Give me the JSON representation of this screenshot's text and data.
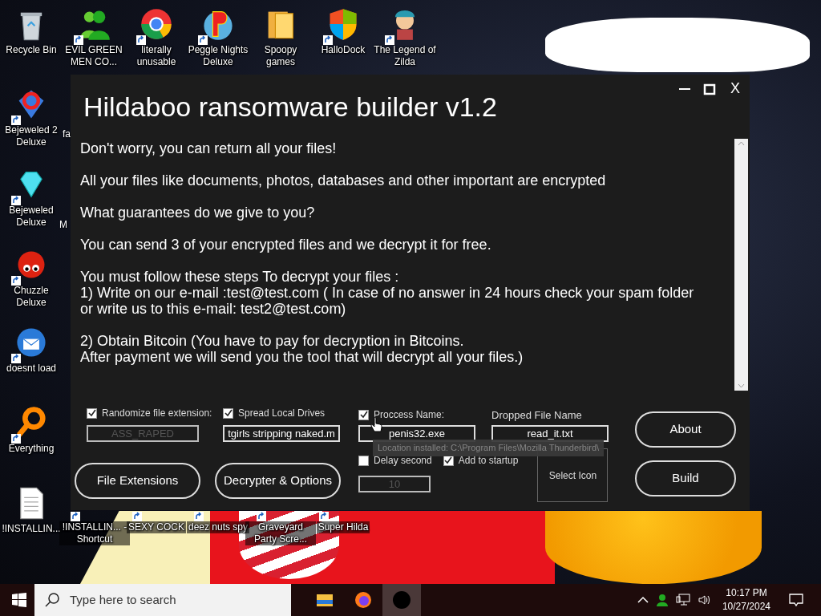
{
  "desktop": {
    "icons": [
      {
        "label": "Recycle Bin",
        "shortcut": false
      },
      {
        "label": "EVIL GREEN MEN CO...",
        "shortcut": true
      },
      {
        "label": "literally unusable",
        "shortcut": true
      },
      {
        "label": "Peggle Nights Deluxe",
        "shortcut": true
      },
      {
        "label": "Spoopy games",
        "shortcut": false
      },
      {
        "label": "HalloDock",
        "shortcut": true
      },
      {
        "label": "The Legend of Zilda",
        "shortcut": true
      },
      {
        "label": "Bejeweled 2 Deluxe",
        "shortcut": true
      },
      {
        "label": "Bejeweled Deluxe",
        "shortcut": true
      },
      {
        "label": "Chuzzle Deluxe",
        "shortcut": true
      },
      {
        "label": "doesnt load",
        "shortcut": true
      },
      {
        "label": "Everything",
        "shortcut": true
      },
      {
        "label": "!INSTALLIN...",
        "shortcut": false
      },
      {
        "label": "!INSTALLIN... - Shortcut",
        "shortcut": true
      },
      {
        "label": "SEXY COCK",
        "shortcut": true
      },
      {
        "label": "deez nuts spy",
        "shortcut": true
      },
      {
        "label": "Graveyard Party Scre...",
        "shortcut": true
      },
      {
        "label": "Super Hilda",
        "shortcut": true
      }
    ],
    "partial_labels": [
      "fa",
      "M"
    ]
  },
  "window": {
    "title": "Hildaboo ransomware builder v1.2",
    "close_label": "X",
    "message": [
      "Don't worry, you can return all your files!",
      "All your files like documents, photos, databases and other important are encrypted",
      "What guarantees do we give to you?",
      "You can send 3 of your encrypted files and we decrypt it for free.",
      "You must follow these steps To decrypt your files :\n1) Write on our e-mail :test@test.com ( In case of no answer in 24 hours check your spam folder\nor write us to this e-mail: test2@test.com)",
      "2) Obtain Bitcoin (You have to pay for decryption in Bitcoins.\nAfter payment we will send you the tool that will decrypt all your files.)"
    ],
    "checkboxes": [
      {
        "label": "Randomize file extension:",
        "checked": true
      },
      {
        "label": "Spread Local Drives",
        "checked": true
      },
      {
        "label": "Proccess Name:",
        "checked": true
      },
      {
        "label": "Delay second",
        "checked": false
      },
      {
        "label": "Add to startup",
        "checked": true
      }
    ],
    "dropped_file_label": "Dropped File Name",
    "fields": [
      {
        "value": "ASS_RAPED",
        "disabled": true
      },
      {
        "value": "tgirls stripping naked.m",
        "disabled": false
      },
      {
        "value": "penis32.exe",
        "disabled": false
      },
      {
        "value": "read_it.txt",
        "disabled": false
      },
      {
        "value": "10",
        "disabled": true
      }
    ],
    "tooltip": "Location installed: C:\\Program Files\\Mozilla Thunderbird\\",
    "buttons": [
      "File Extensions",
      "Decrypter & Options",
      "About",
      "Build"
    ],
    "select_icon": "Select Icon"
  },
  "taskbar": {
    "search_placeholder": "Type here to search",
    "apps": [
      {
        "selected": false
      },
      {
        "selected": false
      },
      {
        "selected": true
      }
    ],
    "time": "10:17 PM",
    "date": "10/27/2024"
  }
}
